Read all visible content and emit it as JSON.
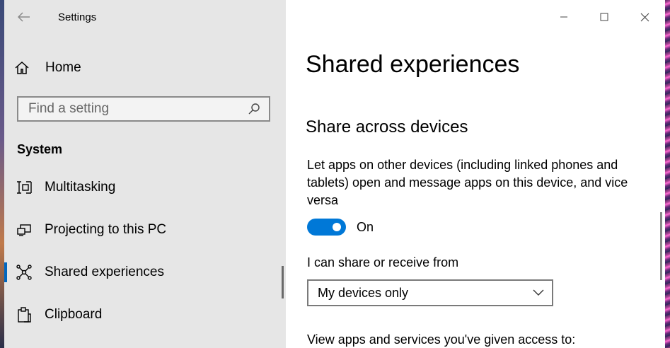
{
  "window": {
    "title": "Settings",
    "controls": [
      "minimize",
      "maximize",
      "close"
    ]
  },
  "sidebar": {
    "home_label": "Home",
    "search": {
      "placeholder": "Find a setting"
    },
    "section_title": "System",
    "items": [
      {
        "label": "Multitasking",
        "icon": "multitasking-icon",
        "selected": false
      },
      {
        "label": "Projecting to this PC",
        "icon": "projecting-icon",
        "selected": false
      },
      {
        "label": "Shared experiences",
        "icon": "shared-experiences-icon",
        "selected": true
      },
      {
        "label": "Clipboard",
        "icon": "clipboard-icon",
        "selected": false
      }
    ]
  },
  "main": {
    "page_title": "Shared experiences",
    "section_title": "Share across devices",
    "description": "Let apps on other devices (including linked phones and tablets) open and message apps on this device, and vice versa",
    "toggle": {
      "state": "On",
      "on": true
    },
    "share_label": "I can share or receive from",
    "dropdown": {
      "selected": "My devices only"
    },
    "cut_text": "View apps and services you've given access to:"
  },
  "colors": {
    "accent": "#0078d7",
    "sidebar_bg": "#e6e6e6",
    "main_bg": "#ffffff"
  }
}
